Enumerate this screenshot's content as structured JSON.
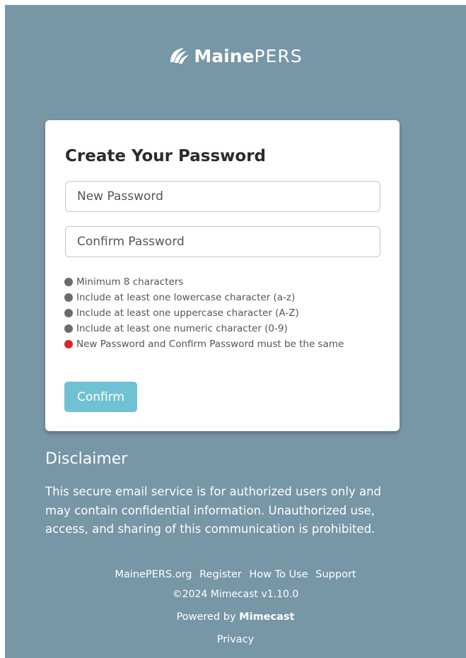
{
  "brand": {
    "name_bold": "Maine",
    "name_light": "PERS",
    "logo_icon": "mainepers-leaf-icon"
  },
  "card": {
    "title": "Create Your Password",
    "new_password_placeholder": "New Password",
    "confirm_password_placeholder": "Confirm Password",
    "new_password_value": "",
    "confirm_password_value": "",
    "rules": [
      {
        "text": "Minimum 8 characters",
        "status": "neutral"
      },
      {
        "text": "Include at least one lowercase character (a-z)",
        "status": "neutral"
      },
      {
        "text": "Include at least one uppercase character (A-Z)",
        "status": "neutral"
      },
      {
        "text": "Include at least one numeric character (0-9)",
        "status": "neutral"
      },
      {
        "text": "New Password and Confirm Password must be the same",
        "status": "error"
      }
    ],
    "confirm_label": "Confirm"
  },
  "disclaimer": {
    "title": "Disclaimer",
    "text": "This secure email service is for authorized users only and may contain confidential information. Unauthorized use, access, and sharing of this communication is prohibited."
  },
  "footer": {
    "links": [
      "MainePERS.org",
      "Register",
      "How To Use",
      "Support"
    ],
    "copyright": "©2024 Mimecast v1.10.0",
    "powered_prefix": "Powered by",
    "powered_brand": "Mimecast",
    "privacy": "Privacy"
  },
  "colors": {
    "background": "#7796a6",
    "card": "#ffffff",
    "button": "#70c1d4",
    "rule_neutral": "#6b6b6b",
    "rule_error": "#d62828"
  }
}
